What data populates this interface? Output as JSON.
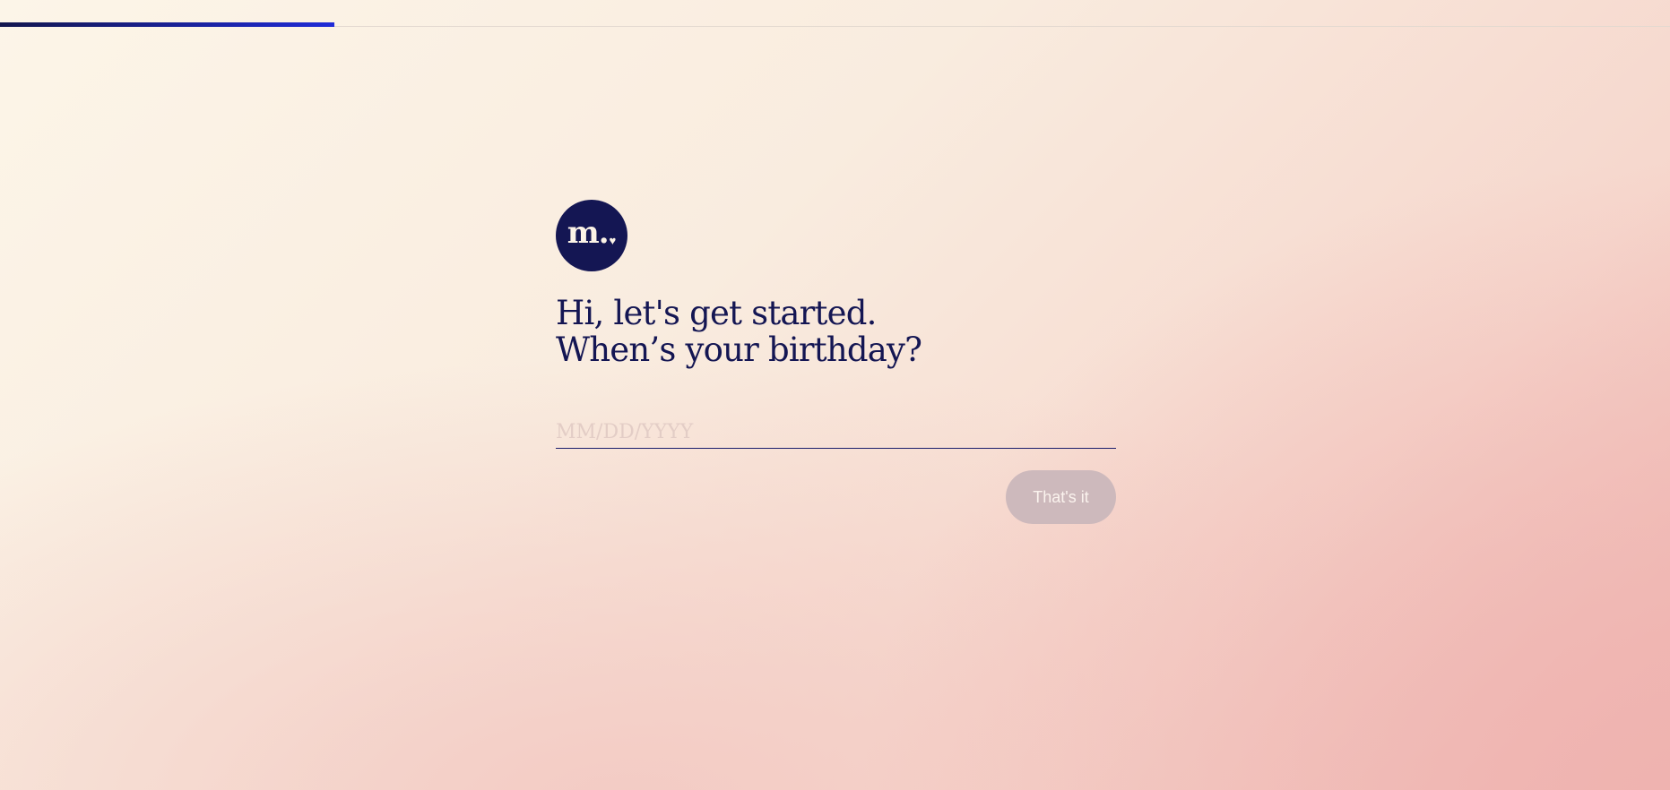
{
  "progress": {
    "fraction": 0.2,
    "color_start": "#13164e",
    "color_end": "#1f2bd8"
  },
  "logo": {
    "letter": "m.",
    "heart": "♥",
    "background": "#141653"
  },
  "heading": {
    "line1": "Hi, let's get started.",
    "line2": "When’s your birthday?"
  },
  "birthday_field": {
    "placeholder": "MM/DD/YYYY",
    "value": ""
  },
  "submit_button": {
    "label": "That's it",
    "state": "disabled"
  },
  "colors": {
    "text": "#141653",
    "button_disabled": "#cdb9bc"
  }
}
